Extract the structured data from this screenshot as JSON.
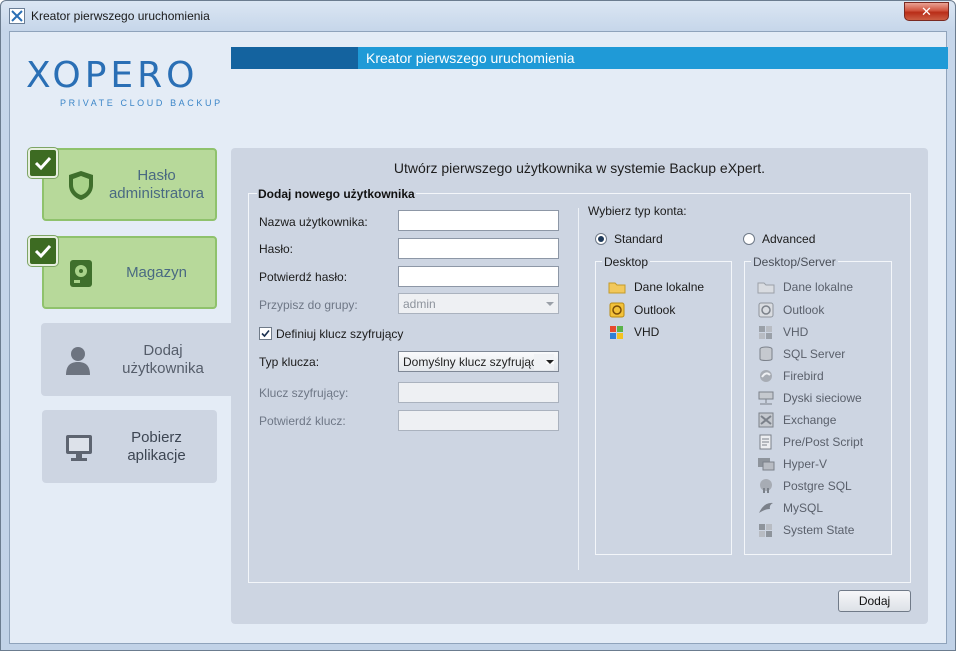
{
  "window": {
    "title": "Kreator pierwszego uruchomienia",
    "close_glyph": "✕"
  },
  "logo": {
    "wordmark": "XOPERO",
    "tagline": "PRIVATE CLOUD BACKUP"
  },
  "header": {
    "title": "Kreator pierwszego uruchomienia"
  },
  "steps": [
    {
      "label": "Hasło administratora",
      "state": "done",
      "icon": "shield-icon"
    },
    {
      "label": "Magazyn",
      "state": "done",
      "icon": "storage-icon"
    },
    {
      "label": "Dodaj użytkownika",
      "state": "active",
      "icon": "user-icon"
    },
    {
      "label": "Pobierz aplikacje",
      "state": "todo",
      "icon": "monitor-icon"
    }
  ],
  "panel": {
    "title": "Utwórz pierwszego użytkownika w systemie Backup eXpert.",
    "form_legend": "Dodaj nowego użytkownika",
    "fields": {
      "username_label": "Nazwa użytkownika:",
      "password_label": "Hasło:",
      "confirm_password_label": "Potwierdź hasło:",
      "group_label": "Przypisz do grupy:",
      "group_value": "admin",
      "define_key_label": "Definiuj klucz szyfrujący",
      "define_key_checked": true,
      "key_type_label": "Typ klucza:",
      "key_type_value": "Domyślny klucz szyfrujący",
      "encryption_key_label": "Klucz szyfrujący:",
      "confirm_key_label": "Potwierdź klucz:"
    },
    "account_type": {
      "label": "Wybierz typ konta:",
      "standard_label": "Standard",
      "advanced_label": "Advanced",
      "selected": "Standard"
    },
    "desktop": {
      "legend": "Desktop",
      "items": [
        {
          "label": "Dane lokalne",
          "icon": "folder-icon"
        },
        {
          "label": "Outlook",
          "icon": "outlook-icon"
        },
        {
          "label": "VHD",
          "icon": "vhd-icon"
        }
      ]
    },
    "desktop_server": {
      "legend": "Desktop/Server",
      "items": [
        {
          "label": "Dane lokalne",
          "icon": "folder-icon"
        },
        {
          "label": "Outlook",
          "icon": "outlook-icon"
        },
        {
          "label": "VHD",
          "icon": "vhd-icon"
        },
        {
          "label": "SQL Server",
          "icon": "database-icon"
        },
        {
          "label": "Firebird",
          "icon": "firebird-icon"
        },
        {
          "label": "Dyski sieciowe",
          "icon": "network-drive-icon"
        },
        {
          "label": "Exchange",
          "icon": "exchange-icon"
        },
        {
          "label": "Pre/Post Script",
          "icon": "script-icon"
        },
        {
          "label": "Hyper-V",
          "icon": "hyperv-icon"
        },
        {
          "label": "Postgre SQL",
          "icon": "postgresql-icon"
        },
        {
          "label": "MySQL",
          "icon": "mysql-icon"
        },
        {
          "label": "System State",
          "icon": "system-state-icon"
        }
      ]
    },
    "add_button": "Dodaj"
  },
  "colors": {
    "header_dark": "#14639f",
    "header_light": "#1f9ad7",
    "step_done": "#b7d99a",
    "panel": "#cdd5e2"
  }
}
